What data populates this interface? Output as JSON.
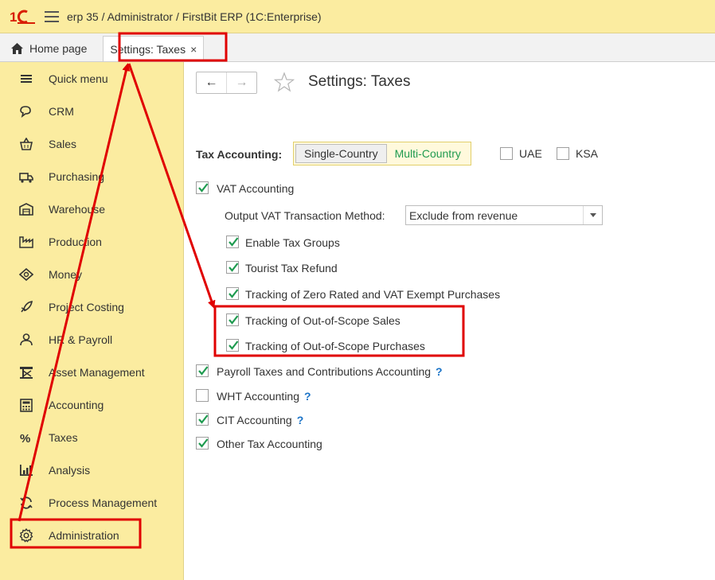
{
  "app": {
    "title": "erp 35 / Administrator / FirstBit ERP  (1C:Enterprise)",
    "logo_icon": "1c-logo-icon",
    "menu_icon": "hamburger-icon"
  },
  "tabs": {
    "home_label": "Home page",
    "active_label": "Settings: Taxes",
    "close_glyph": "×"
  },
  "sidebar": {
    "items": [
      {
        "label": "Quick menu",
        "icon": "quick-menu-icon"
      },
      {
        "label": "CRM",
        "icon": "crm-icon"
      },
      {
        "label": "Sales",
        "icon": "sales-icon"
      },
      {
        "label": "Purchasing",
        "icon": "purchasing-icon"
      },
      {
        "label": "Warehouse",
        "icon": "warehouse-icon"
      },
      {
        "label": "Production",
        "icon": "production-icon"
      },
      {
        "label": "Money",
        "icon": "money-icon"
      },
      {
        "label": "Project Costing",
        "icon": "project-costing-icon"
      },
      {
        "label": "HR & Payroll",
        "icon": "hr-payroll-icon"
      },
      {
        "label": "Asset Management",
        "icon": "asset-management-icon"
      },
      {
        "label": "Accounting",
        "icon": "accounting-icon"
      },
      {
        "label": "Taxes",
        "icon": "taxes-icon"
      },
      {
        "label": "Analysis",
        "icon": "analysis-icon"
      },
      {
        "label": "Process Management",
        "icon": "process-management-icon"
      },
      {
        "label": "Administration",
        "icon": "gear-icon"
      }
    ]
  },
  "main": {
    "back_glyph": "←",
    "forward_glyph": "→",
    "title": "Settings: Taxes",
    "tax_accounting_label": "Tax Accounting:",
    "mode_options": [
      "Single-Country",
      "Multi-Country"
    ],
    "selected_mode": "Single-Country",
    "uae_label": "UAE",
    "ksa_label": "KSA",
    "vat_accounting_label": "VAT Accounting",
    "output_vat_label": "Output VAT Transaction Method:",
    "output_vat_value": "Exclude from revenue",
    "enable_tax_groups_label": "Enable Tax Groups",
    "tourist_tax_refund_label": "Tourist Tax Refund",
    "zero_rated_label": "Tracking of Zero Rated and VAT Exempt Purchases",
    "oos_sales_label": "Tracking of Out-of-Scope Sales",
    "oos_purchases_label": "Tracking of Out-of-Scope Purchases",
    "payroll_taxes_label": "Payroll Taxes and Contributions Accounting",
    "wht_label": "WHT Accounting",
    "cit_label": "CIT Accounting",
    "other_tax_label": "Other Tax Accounting",
    "help_glyph": "?"
  },
  "checkboxes": {
    "uae": false,
    "ksa": false,
    "vat_accounting": true,
    "enable_tax_groups": true,
    "tourist_tax_refund": true,
    "zero_rated": true,
    "oos_sales": true,
    "oos_purchases": true,
    "payroll_taxes": true,
    "wht": false,
    "cit": true,
    "other_tax": true
  },
  "colors": {
    "sidebar_bg": "#fbeca0",
    "check_green": "#1f9b50",
    "help_blue": "#1a73c7",
    "annotation_red": "#e00000"
  }
}
